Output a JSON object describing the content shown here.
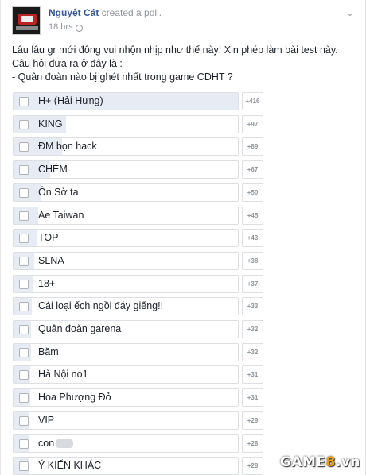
{
  "post": {
    "author": "Nguyệt Cát",
    "action": "created a poll.",
    "time": "18 hrs",
    "lines": [
      "Lâu lâu gr mới đông vui nhộn nhịp như thế này! Xin phép làm bài test này.",
      "Câu hỏi đưa ra ở đây là :",
      "- Quân đoàn nào bị ghét nhất trong game CDHT ?"
    ]
  },
  "poll": {
    "options": [
      {
        "label": "H+ (Hải Hưng)",
        "count": "+416",
        "votes": 416
      },
      {
        "label": "KING",
        "count": "+97",
        "votes": 97
      },
      {
        "label": "ĐM bọn hack",
        "count": "+89",
        "votes": 89
      },
      {
        "label": "CHÉM",
        "count": "+67",
        "votes": 67
      },
      {
        "label": "Ôn Sờ ta",
        "count": "+50",
        "votes": 50
      },
      {
        "label": "Ae Taiwan",
        "count": "+45",
        "votes": 45
      },
      {
        "label": "TOP",
        "count": "+43",
        "votes": 43
      },
      {
        "label": "SLNA",
        "count": "+38",
        "votes": 38
      },
      {
        "label": "18+",
        "count": "+37",
        "votes": 37
      },
      {
        "label": "Cái loại ếch ngồi đáy giếng!!",
        "count": "+33",
        "votes": 33
      },
      {
        "label": "Quân đoàn garena",
        "count": "+32",
        "votes": 32
      },
      {
        "label": "Băm",
        "count": "+32",
        "votes": 32
      },
      {
        "label": "Hà Nội no1",
        "count": "+31",
        "votes": 31
      },
      {
        "label": "Hoa Phượng Đỏ",
        "count": "+31",
        "votes": 31
      },
      {
        "label": "VIP",
        "count": "+29",
        "votes": 29
      },
      {
        "label": "con",
        "count": "+28",
        "votes": 28
      },
      {
        "label": "Ý KIẾN KHÁC",
        "count": "+28",
        "votes": 28
      }
    ]
  },
  "watermark": {
    "text": "GAME",
    "num": "8",
    "suffix": ".vn"
  }
}
